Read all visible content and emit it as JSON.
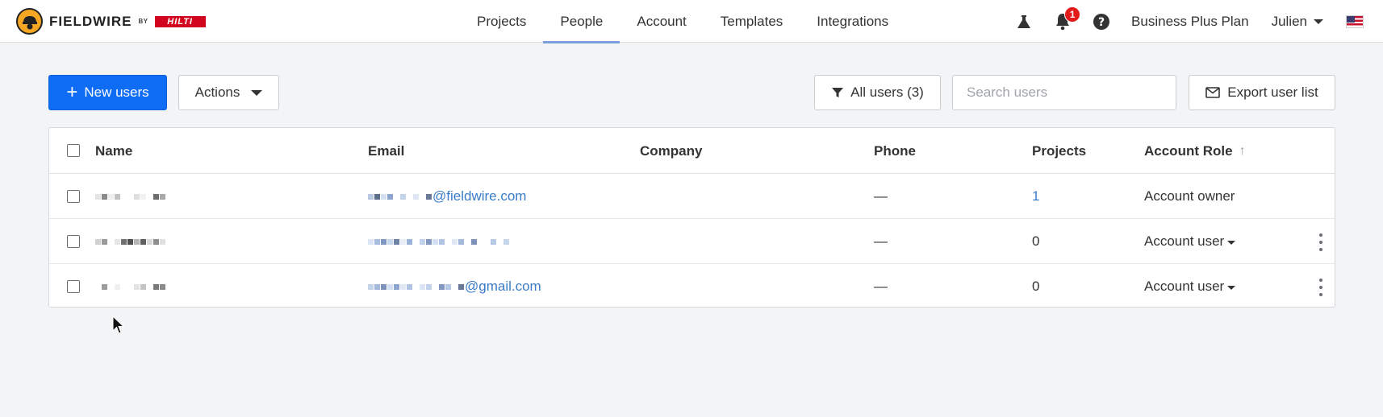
{
  "header": {
    "logo_word": "FIELDWIRE",
    "logo_by": "BY",
    "logo_brand": "HILTI",
    "nav": [
      {
        "label": "Projects",
        "active": false
      },
      {
        "label": "People",
        "active": true
      },
      {
        "label": "Account",
        "active": false
      },
      {
        "label": "Templates",
        "active": false
      },
      {
        "label": "Integrations",
        "active": false
      }
    ],
    "notification_count": "1",
    "plan_label": "Business Plus Plan",
    "user_name": "Julien",
    "icons": [
      "flask-icon",
      "bell-icon",
      "help-icon",
      "us-flag-icon"
    ]
  },
  "toolbar": {
    "new_users_label": "New users",
    "actions_label": "Actions",
    "filter_label": "All users (3)",
    "search_placeholder": "Search users",
    "export_label": "Export user list"
  },
  "table": {
    "columns": {
      "name": "Name",
      "email": "Email",
      "company": "Company",
      "phone": "Phone",
      "projects": "Projects",
      "role": "Account Role"
    },
    "rows": [
      {
        "email_suffix": "@fieldwire.com",
        "phone": "—",
        "projects": "1",
        "role": "Account owner",
        "role_dropdown": false
      },
      {
        "email_suffix": "",
        "phone": "—",
        "projects": "0",
        "role": "Account user",
        "role_dropdown": true
      },
      {
        "email_suffix": "@gmail.com",
        "phone": "—",
        "projects": "0",
        "role": "Account user",
        "role_dropdown": true
      }
    ]
  },
  "colors": {
    "primary": "#0f6cf5",
    "link": "#3a7bc8",
    "active_tab": "#7aa0de",
    "notification": "#e31a1a"
  }
}
